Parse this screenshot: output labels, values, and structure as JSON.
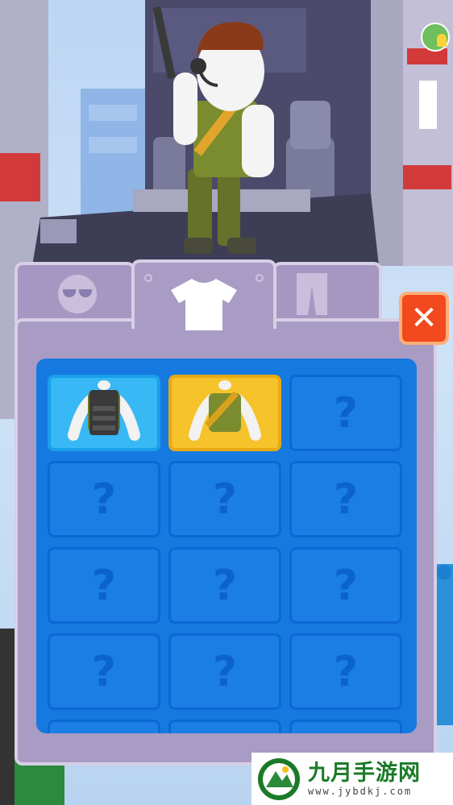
{
  "tabs": [
    {
      "name": "accessories",
      "icon": "sunglasses-icon"
    },
    {
      "name": "tops",
      "icon": "tshirt-icon",
      "active": true
    },
    {
      "name": "pants",
      "icon": "pants-icon"
    }
  ],
  "close_label": "✕",
  "items": [
    {
      "state": "owned",
      "icon": "tactical-vest-icon"
    },
    {
      "state": "selected",
      "icon": "bandolier-shirt-icon"
    },
    {
      "state": "locked",
      "label": "?"
    },
    {
      "state": "locked",
      "label": "?"
    },
    {
      "state": "locked",
      "label": "?"
    },
    {
      "state": "locked",
      "label": "?"
    },
    {
      "state": "locked",
      "label": "?"
    },
    {
      "state": "locked",
      "label": "?"
    },
    {
      "state": "locked",
      "label": "?"
    },
    {
      "state": "locked",
      "label": "?"
    },
    {
      "state": "locked",
      "label": "?"
    },
    {
      "state": "locked",
      "label": "?"
    }
  ],
  "watermark": {
    "title": "九月手游网",
    "url": "www.jybdkj.com"
  },
  "colors": {
    "panel": "#a89bc4",
    "grid": "#1679e0",
    "selected": "#f6c42a",
    "owned": "#38b8f5",
    "close": "#f24a1e"
  }
}
